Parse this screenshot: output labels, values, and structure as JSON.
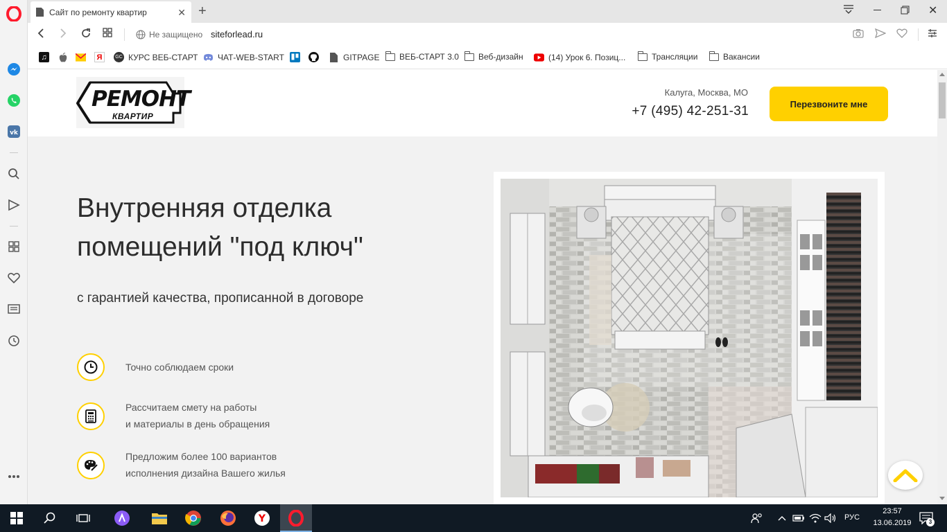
{
  "browser": {
    "tab_title": "Сайт по ремонту квартир",
    "security_label": "Не защищено",
    "url": "siteforlead.ru"
  },
  "bookmarks": [
    {
      "label": "",
      "icon": "music-icon"
    },
    {
      "label": "",
      "icon": "apple-icon"
    },
    {
      "label": "",
      "icon": "mail-icon"
    },
    {
      "label": "",
      "icon": "yandex-icon"
    },
    {
      "label": "КУРС ВЕБ-СТАРТ",
      "icon": "gc-icon"
    },
    {
      "label": "ЧАТ-WEB-START",
      "icon": "discord-icon"
    },
    {
      "label": "",
      "icon": "trello-icon"
    },
    {
      "label": "",
      "icon": "github-icon"
    },
    {
      "label": "GITPAGE",
      "icon": "page-icon"
    },
    {
      "label": "ВЕБ-СТАРТ 3.0",
      "icon": "folder-icon"
    },
    {
      "label": "Веб-дизайн",
      "icon": "folder-icon"
    },
    {
      "label": "(14) Урок 6. Позиц...",
      "icon": "youtube-icon"
    },
    {
      "label": "Трансляции",
      "icon": "folder-icon"
    },
    {
      "label": "Вакансии",
      "icon": "folder-icon"
    }
  ],
  "site": {
    "logo_big": "РЕМОНТ",
    "logo_small": "КВАРТИР",
    "region": "Калуга, Москва, МО",
    "phone": "+7 (495) 42-251-31",
    "callback_label": "Перезвоните мне",
    "hero_title_line1": "Внутренняя отделка",
    "hero_title_line2": "помещений \"под ключ\"",
    "hero_subtitle": "с гарантией качества, прописанной в договоре",
    "features": [
      {
        "icon": "clock-icon",
        "line1": "Точно соблюдаем сроки",
        "line2": ""
      },
      {
        "icon": "calculator-icon",
        "line1": "Рассчитаем смету на работы",
        "line2": "и материалы в день обращения"
      },
      {
        "icon": "palette-icon",
        "line1": "Предложим более 100 вариантов",
        "line2": "исполнения дизайна Вашего жилья"
      }
    ]
  },
  "taskbar": {
    "language": "РУС",
    "time": "23:57",
    "date": "13.06.2019",
    "notifications": "3"
  },
  "colors": {
    "accent": "#ffd000",
    "opera_red": "#ff1b2d",
    "taskbar": "#101a24"
  }
}
